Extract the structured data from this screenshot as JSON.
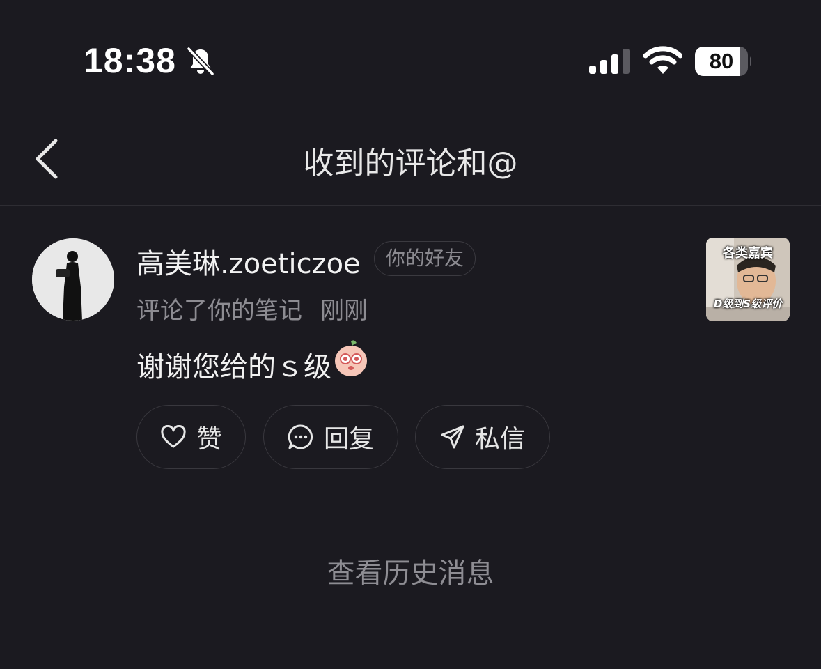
{
  "status_bar": {
    "time": "18:38",
    "battery": "80",
    "icons": [
      "bell-slash-icon",
      "cellular-signal-icon",
      "wifi-icon",
      "battery-icon"
    ]
  },
  "nav": {
    "title": "收到的评论和@",
    "back_icon": "chevron-left-icon"
  },
  "notification": {
    "username": "高美琳.zoeticzoe",
    "badge": "你的好友",
    "action_text": "评论了你的笔记",
    "time_ago": "刚刚",
    "comment": "谢谢您给的ｓ级",
    "thumbnail": {
      "top_text": "各类嘉宾",
      "bottom_text": "D级到S级评价"
    },
    "buttons": {
      "like": "赞",
      "reply": "回复",
      "message": "私信"
    }
  },
  "footer": {
    "history_link": "查看历史消息"
  },
  "colors": {
    "background": "#1b1a20",
    "text_primary": "#f1f1f1",
    "text_secondary": "#8d8c92",
    "border": "#39383e"
  }
}
